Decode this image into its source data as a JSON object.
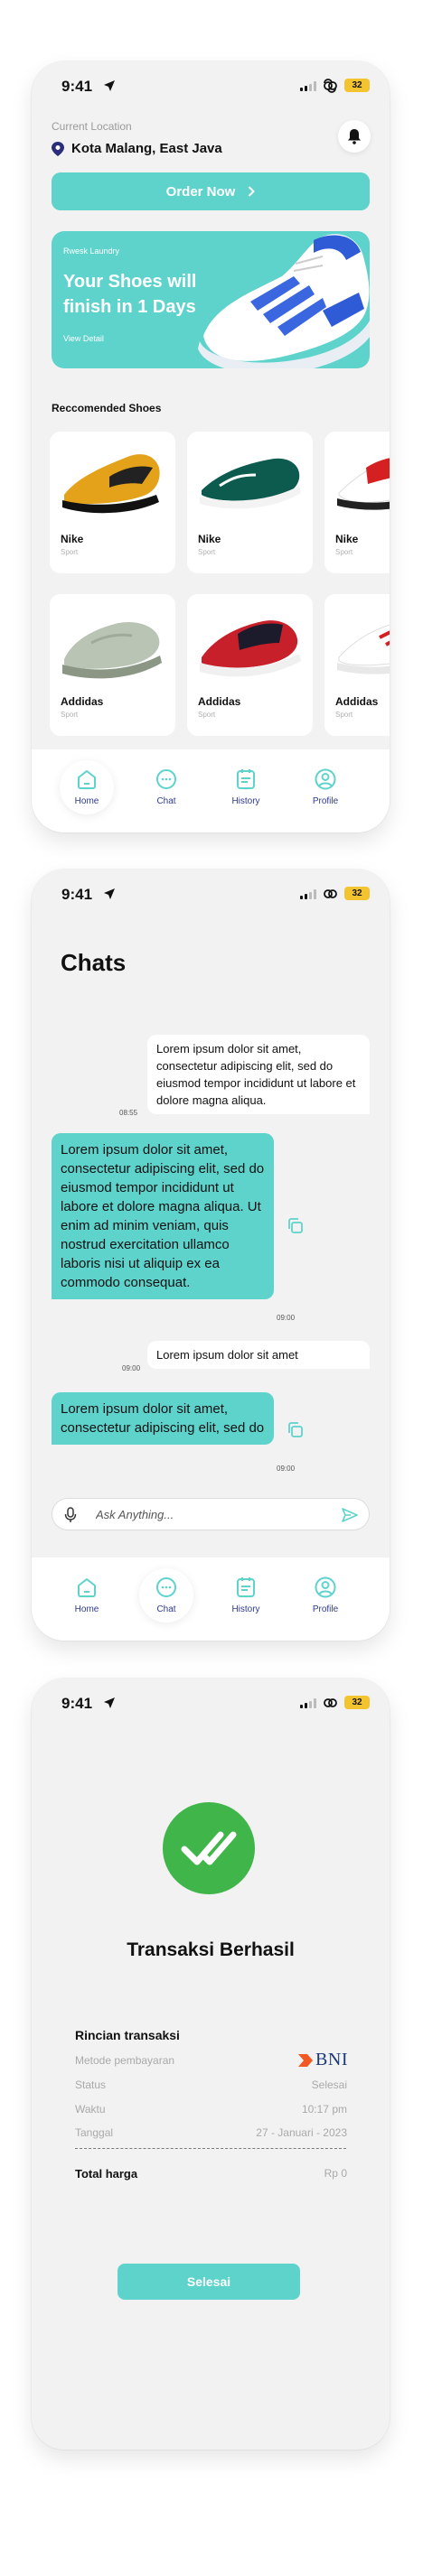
{
  "status_bar": {
    "time": "9:41",
    "battery": "32"
  },
  "home": {
    "location_label": "Current Location",
    "location": "Kota Malang, East Java",
    "order_button": "Order Now",
    "banner": {
      "subtitle": "Rwesk Laundry",
      "title": "Your Shoes will finish in 1 Days",
      "link": "View Detail"
    },
    "section_title": "Reccomended Shoes",
    "products": [
      {
        "name": "Nike",
        "category": "Sport"
      },
      {
        "name": "Nike",
        "category": "Sport"
      },
      {
        "name": "Nike",
        "category": "Sport"
      },
      {
        "name": "Addidas",
        "category": "Sport"
      },
      {
        "name": "Addidas",
        "category": "Sport"
      },
      {
        "name": "Addidas",
        "category": "Sport"
      }
    ]
  },
  "nav": {
    "items": [
      {
        "label": "Home",
        "icon": "home-icon"
      },
      {
        "label": "Chat",
        "icon": "chat-icon"
      },
      {
        "label": "History",
        "icon": "history-icon"
      },
      {
        "label": "Profile",
        "icon": "profile-icon"
      }
    ]
  },
  "chat": {
    "title": "Chats",
    "messages": [
      {
        "from": "other",
        "text": "Lorem ipsum dolor sit amet, consectetur adipiscing elit, sed do eiusmod tempor incididunt ut labore et dolore magna aliqua.",
        "time": "08:55"
      },
      {
        "from": "me",
        "text": "Lorem ipsum dolor sit amet, consectetur adipiscing elit, sed do eiusmod tempor incididunt ut labore et dolore magna aliqua. Ut enim ad minim veniam, quis nostrud exercitation ullamco laboris nisi ut aliquip ex ea commodo consequat.",
        "time": "09:00"
      },
      {
        "from": "other",
        "text": "Lorem ipsum dolor sit amet",
        "time": "09:00"
      },
      {
        "from": "me",
        "text": "Lorem ipsum dolor sit amet, consectetur adipiscing elit, sed do",
        "time": "09:00"
      }
    ],
    "input_placeholder": "Ask Anything..."
  },
  "transaction": {
    "title": "Transaksi Berhasil",
    "detail_title": "Rincian transaksi",
    "rows": [
      {
        "label": "Metode pembayaran",
        "value": "BNI"
      },
      {
        "label": "Status",
        "value": "Selesai"
      },
      {
        "label": "Waktu",
        "value": "10:17 pm"
      },
      {
        "label": "Tanggal",
        "value": "27 - Januari - 2023"
      }
    ],
    "total_label": "Total harga",
    "total_value": "Rp 0",
    "done_button": "Selesai"
  },
  "colors": {
    "accent": "#5ed3cc",
    "nav_text": "#2f3a8f",
    "success": "#3fb54a",
    "battery": "#f4c430"
  }
}
